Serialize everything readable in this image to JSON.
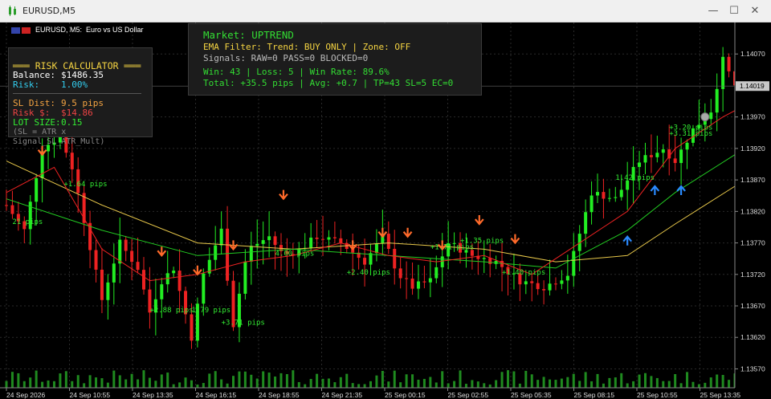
{
  "window": {
    "title": "EURUSD,M5",
    "minimize": "—",
    "maximize": "☐",
    "close": "✕"
  },
  "chart_header": {
    "symbol": "EURUSD, M5:",
    "description": "Euro vs US Dollar"
  },
  "info_panel": {
    "market": "Market: UPTREND",
    "ema_filter": "EMA Filter: Trend: BUY ONLY | Zone: OFF",
    "signals": "Signals: RAW=0 PASS=0 BLOCKED=0",
    "stats1": "Win: 43 | Loss: 5 | Win Rate: 89.6%",
    "stats2": "Total: +35.5 pips | Avg: +0.7 | TP=43 SL=5 EC=0"
  },
  "risk_panel": {
    "title": "═══ RISK CALCULATOR ═══",
    "balance_label": "Balance:",
    "balance_value": "$1486.35",
    "risk_label": "Risk:",
    "risk_value": "1.00%",
    "sl_label": "SL Dist:",
    "sl_value": "9.5 pips",
    "risk_usd_label": "Risk $:",
    "risk_usd_value": "$14.86",
    "lot_label": "LOT SIZE:",
    "lot_value": "0.15",
    "formula": "(SL = ATR x Signal_SL_ATR_Mult)"
  },
  "colors": {
    "bull": "#22ee22",
    "bear": "#ee2222",
    "ema_fast": "#ee2222",
    "ema_slow": "#22cc22",
    "ema_long": "#e8c84a",
    "grid": "#2a2a2a"
  },
  "chart_data": {
    "type": "candlestick",
    "yaxis": {
      "ticks": [
        "1.14070",
        "1.13970",
        "1.13920",
        "1.13870",
        "1.13820",
        "1.13770",
        "1.13720",
        "1.13670",
        "1.13620",
        "1.13570"
      ],
      "tick_values": [
        1.1407,
        1.1397,
        1.1392,
        1.1387,
        1.1382,
        1.1377,
        1.1372,
        1.1367,
        1.1362,
        1.1357
      ],
      "current_price": "1.14019",
      "current_value": 1.14019,
      "range": [
        1.1354,
        1.1412
      ]
    },
    "xaxis": {
      "ticks": [
        "24 Sep 2026",
        "24 Sep 10:55",
        "24 Sep 13:35",
        "24 Sep 16:15",
        "24 Sep 18:55",
        "24 Sep 21:35",
        "25 Sep 00:15",
        "25 Sep 02:55",
        "25 Sep 05:35",
        "25 Sep 08:15",
        "25 Sep 10:55",
        "25 Sep 13:35"
      ]
    },
    "path": [
      [
        0,
        1.1383
      ],
      [
        1.5,
        1.1379
      ],
      [
        3,
        1.1392
      ],
      [
        4.5,
        1.1394
      ],
      [
        5.5,
        1.1389
      ],
      [
        8,
        1.1368
      ],
      [
        9.5,
        1.1377
      ],
      [
        11,
        1.1373
      ],
      [
        12,
        1.1366
      ],
      [
        13,
        1.1371
      ],
      [
        14,
        1.1373
      ],
      [
        15.5,
        1.1362
      ],
      [
        16.5,
        1.1372
      ],
      [
        18,
        1.1379
      ],
      [
        19,
        1.1364
      ],
      [
        20.2,
        1.1376
      ],
      [
        22,
        1.1378
      ],
      [
        23.2,
        1.1375
      ],
      [
        24.6,
        1.1376
      ],
      [
        26,
        1.1378
      ],
      [
        28,
        1.1377
      ],
      [
        30,
        1.1374
      ],
      [
        31.5,
        1.1378
      ],
      [
        32.8,
        1.1372
      ],
      [
        34,
        1.137
      ],
      [
        35.5,
        1.1371
      ],
      [
        37,
        1.1377
      ],
      [
        39,
        1.1375
      ],
      [
        41,
        1.1374
      ],
      [
        43,
        1.1371
      ],
      [
        45,
        1.137
      ],
      [
        47,
        1.1372
      ],
      [
        49,
        1.1385
      ],
      [
        51,
        1.1384
      ],
      [
        53,
        1.139
      ],
      [
        55,
        1.1392
      ],
      [
        56,
        1.139
      ],
      [
        57.5,
        1.1395
      ],
      [
        59,
        1.1398
      ],
      [
        60,
        1.1406
      ],
      [
        61,
        1.1402
      ]
    ],
    "ema_fast": [
      [
        0,
        1.1385
      ],
      [
        4,
        1.1389
      ],
      [
        8,
        1.1376
      ],
      [
        12,
        1.1371
      ],
      [
        16,
        1.1372
      ],
      [
        20,
        1.1374
      ],
      [
        24,
        1.1375
      ],
      [
        28,
        1.1377
      ],
      [
        32,
        1.1375
      ],
      [
        36,
        1.1374
      ],
      [
        40,
        1.1375
      ],
      [
        44,
        1.1372
      ],
      [
        48,
        1.1377
      ],
      [
        52,
        1.1382
      ],
      [
        56,
        1.1392
      ],
      [
        60,
        1.1397
      ],
      [
        61,
        1.1398
      ]
    ],
    "ema_slow": [
      [
        0,
        1.1384
      ],
      [
        8,
        1.1379
      ],
      [
        16,
        1.1375
      ],
      [
        24,
        1.1376
      ],
      [
        32,
        1.1375
      ],
      [
        40,
        1.1374
      ],
      [
        46,
        1.1373
      ],
      [
        52,
        1.1379
      ],
      [
        56,
        1.1385
      ],
      [
        61,
        1.1391
      ]
    ],
    "ema_long": [
      [
        0,
        1.139
      ],
      [
        8,
        1.1383
      ],
      [
        16,
        1.1377
      ],
      [
        24,
        1.1376
      ],
      [
        32,
        1.1377
      ],
      [
        40,
        1.1376
      ],
      [
        46,
        1.1374
      ],
      [
        52,
        1.1375
      ],
      [
        56,
        1.138
      ],
      [
        61,
        1.1386
      ]
    ],
    "sell_arrows": [
      [
        3,
        1.1391
      ],
      [
        13,
        1.1375
      ],
      [
        16,
        1.1372
      ],
      [
        19,
        1.1376
      ],
      [
        23.2,
        1.1384
      ],
      [
        29,
        1.1376
      ],
      [
        31.5,
        1.1378
      ],
      [
        33.6,
        1.1378
      ],
      [
        36.5,
        1.1376
      ],
      [
        39.6,
        1.138
      ],
      [
        42.6,
        1.1377
      ]
    ],
    "buy_arrows": [
      [
        52,
        1.1378
      ],
      [
        54.3,
        1.1386
      ],
      [
        56.5,
        1.1386
      ]
    ],
    "trade_labels": [
      {
        "text": "21 pips",
        "x": 0.5,
        "y": 1.138
      },
      {
        "text": "+1.64 pips",
        "x": 4.8,
        "y": 1.1386
      },
      {
        "text": "+2.88 pips",
        "x": 12,
        "y": 1.1366
      },
      {
        "text": "1.79 pips",
        "x": 15.5,
        "y": 1.1366
      },
      {
        "text": "+3.71 pips",
        "x": 18,
        "y": 1.1364
      },
      {
        "text": "4.00 pips",
        "x": 22.5,
        "y": 1.1375
      },
      {
        "text": "+2.40 pips",
        "x": 28.5,
        "y": 1.1372
      },
      {
        "text": "+1.35 pips",
        "x": 38,
        "y": 1.1377
      },
      {
        "text": "+1.71 pips",
        "x": 35.5,
        "y": 1.1376
      },
      {
        "text": "+1.40 pips",
        "x": 41.5,
        "y": 1.1372
      },
      {
        "text": "1.42 pips",
        "x": 51,
        "y": 1.1387
      },
      {
        "text": "+3.20 pips",
        "x": 55.5,
        "y": 1.1395
      },
      {
        "text": "+3.31 pips",
        "x": 55.5,
        "y": 1.1394
      }
    ],
    "close_marker": [
      58.5,
      1.1397
    ]
  }
}
